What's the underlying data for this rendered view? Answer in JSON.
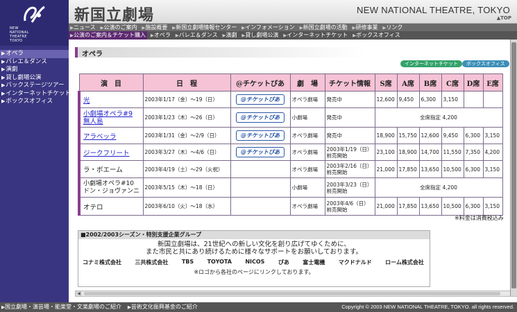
{
  "header": {
    "logo_text": [
      "NEW",
      "NATIONAL",
      "THEATRE",
      "TOKYO"
    ],
    "title_jp": "新国立劇場",
    "title_en": "NEW NATIONAL THEATRE, TOKYO",
    "top_link": "▲TOP"
  },
  "nav": {
    "row1": [
      "ニュース",
      "公演のご案内",
      "施設概要",
      "新国立劇場情報センター",
      "インフォメーション",
      "新国立劇場の活動",
      "研修事業",
      "リンク"
    ],
    "row2": [
      "公演のご案内＆チケット購入",
      "オペラ",
      "バレエ＆ダンス",
      "演劇",
      "貸し劇場公演",
      "インターネットチケット",
      "ボックスオフィス"
    ]
  },
  "sidebar": {
    "items": [
      "オペラ",
      "バレエ＆ダンス",
      "演劇",
      "貸し劇場公演",
      "バックステージツアー",
      "インターネットチケット",
      "ボックスオフィス"
    ]
  },
  "section": {
    "title": "オペラ",
    "pill_internet": "インターネットチケット",
    "pill_box": "ボックスオフィス"
  },
  "table": {
    "headers": [
      "演　目",
      "日　程",
      "@チケットぴあ",
      "劇　場",
      "チケット情報",
      "S席",
      "A席",
      "B席",
      "C席",
      "D席",
      "E席"
    ],
    "pia_label": "@チケットぴあ",
    "rows": [
      {
        "title": "光",
        "date": "2003年1/17（金）〜19（日）",
        "theatre": "オペラ劇場",
        "sale": "発売中",
        "s": "12,600",
        "a": "9,450",
        "b": "6,300",
        "c": "3,150",
        "d": "",
        "e": ""
      },
      {
        "title": "小劇場オペラ#9 無人島",
        "date": "2003年1/23（木）〜26（日）",
        "theatre": "小劇場",
        "sale": "発売中",
        "merged": "全席指定 4,200"
      },
      {
        "title": "アラベッラ",
        "date": "2003年1/31（金）〜2/9（日）",
        "theatre": "オペラ劇場",
        "sale": "発売中",
        "s": "18,900",
        "a": "15,750",
        "b": "12,600",
        "c": "9,450",
        "d": "6,300",
        "e": "3,150"
      },
      {
        "title": "ジークフリート",
        "date": "2003年3/27（木）〜4/6（日）",
        "theatre": "オペラ劇場",
        "sale": "2003年1/19（日）前売開始",
        "s": "23,100",
        "a": "18,900",
        "b": "14,700",
        "c": "11,550",
        "d": "7,350",
        "e": "4,200"
      },
      {
        "title": "ラ・ボエーム",
        "date": "2003年4/19（土）〜29（火祝）",
        "theatre": "オペラ劇場",
        "sale": "2003年2/16（日）前売開始",
        "s": "21,000",
        "a": "17,850",
        "b": "13,650",
        "c": "10,500",
        "d": "6,300",
        "e": "3,150"
      },
      {
        "title": "小劇場オペラ#10 ドン・ジョヴァンニ",
        "date": "2003年5/15（木）〜18（日）",
        "theatre": "小劇場",
        "sale": "2003年3/23（日）前売開始",
        "merged": "全席指定 4,200"
      },
      {
        "title": "オテロ",
        "date": "2003年6/10（火）〜18（水）",
        "theatre": "オペラ劇場",
        "sale": "2003年4/6（日）前売開始",
        "s": "21,000",
        "a": "17,850",
        "b": "13,650",
        "c": "10,500",
        "d": "6,300",
        "e": "3,150"
      }
    ],
    "note": "※料金は消費税込み"
  },
  "sponsor": {
    "heading": "■2002/2003シーズン・特別支援企業グループ",
    "message_1": "新国立劇場は、21世紀への新しい文化を創り広げてゆくために、",
    "message_2": "また市民と共にあり続けるために様々なサポートをお願いしております。",
    "logos": [
      "コナミ株式会社",
      "三共株式会社",
      "TBS",
      "TOYOTA",
      "NICOS",
      "ぴあ",
      "富士電機",
      "マクドナルド",
      "ローム株式会社"
    ],
    "footer": "※ロゴから各社のページにリンクしております。"
  },
  "footer": {
    "links": [
      "国立劇場・演芸場・能楽堂・文楽劇場のご紹介",
      "芸術文化振興基金のご紹介"
    ],
    "copyright": "Copyright © 2003 NEW NATIONAL THEATRE, TOKYO. all rights reserved."
  }
}
